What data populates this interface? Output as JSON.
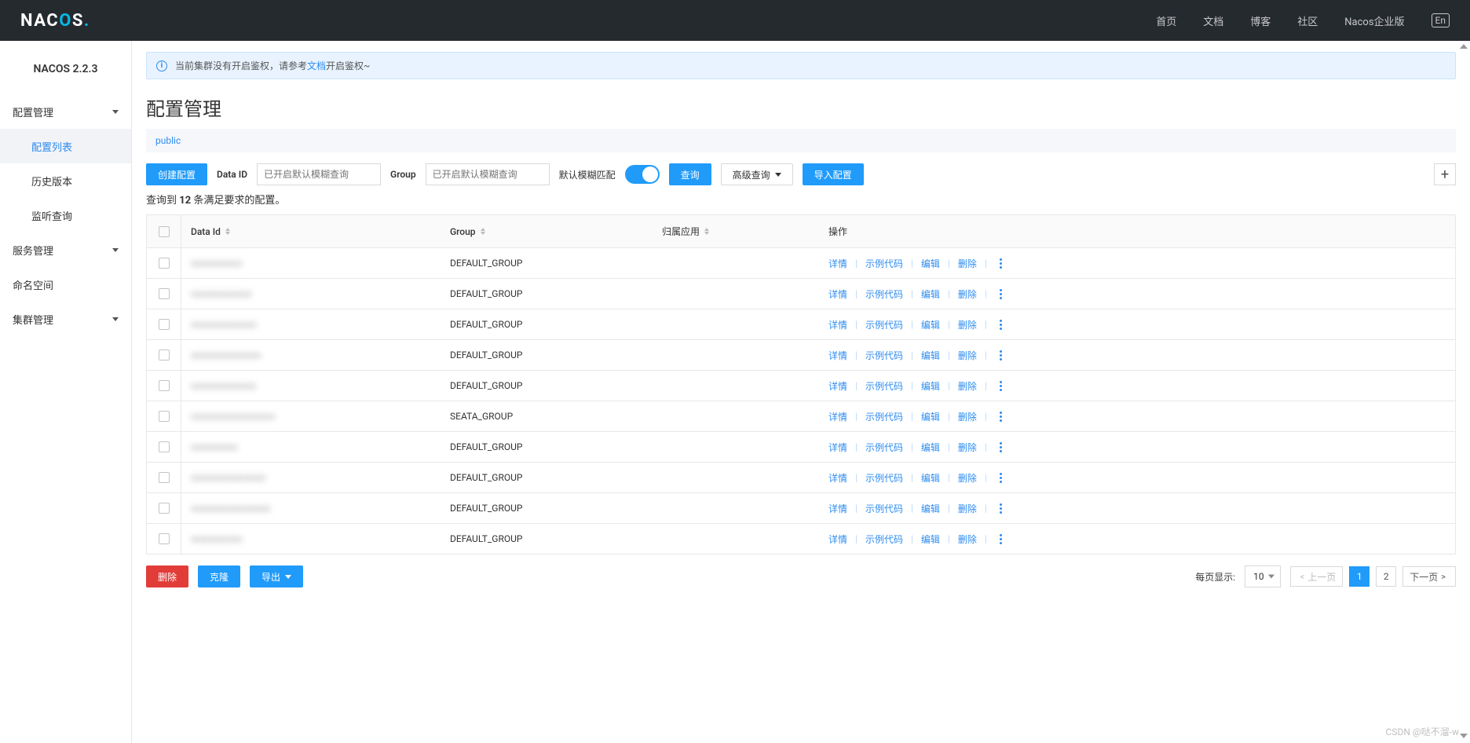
{
  "header": {
    "logo_text": "NACOS",
    "nav": [
      "首页",
      "文档",
      "博客",
      "社区",
      "Nacos企业版"
    ],
    "lang_badge": "En"
  },
  "sidebar": {
    "title": "NACOS 2.2.3",
    "groups": [
      {
        "label": "配置管理",
        "expanded": true,
        "children": [
          {
            "label": "配置列表",
            "active": true
          },
          {
            "label": "历史版本",
            "active": false
          },
          {
            "label": "监听查询",
            "active": false
          }
        ]
      },
      {
        "label": "服务管理",
        "expanded": false
      },
      {
        "label": "命名空间",
        "leaf": true
      },
      {
        "label": "集群管理",
        "expanded": false
      }
    ]
  },
  "notice": {
    "text_before": "当前集群没有开启鉴权，请参考",
    "link_text": "文档",
    "text_after": "开启鉴权~"
  },
  "page": {
    "title": "配置管理",
    "namespace": "public"
  },
  "filters": {
    "create_btn": "创建配置",
    "dataid_label": "Data ID",
    "dataid_placeholder": "已开启默认模糊查询",
    "group_label": "Group",
    "group_placeholder": "已开启默认模糊查询",
    "fuzzy_label": "默认模糊匹配",
    "search_btn": "查询",
    "advanced_btn": "高级查询",
    "import_btn": "导入配置"
  },
  "result_line": {
    "prefix": "查询到 ",
    "count": "12",
    "suffix": " 条满足要求的配置。"
  },
  "table": {
    "headers": {
      "dataid": "Data Id",
      "group": "Group",
      "app": "归属应用",
      "ops": "操作"
    },
    "op_labels": {
      "detail": "详情",
      "example": "示例代码",
      "edit": "编辑",
      "delete": "删除"
    },
    "rows": [
      {
        "dataid": "xxxxxxxxxxx",
        "group": "DEFAULT_GROUP",
        "app": ""
      },
      {
        "dataid": "xxxxxxxxxxxxx",
        "group": "DEFAULT_GROUP",
        "app": ""
      },
      {
        "dataid": "xxxxxxxxxxxxxx",
        "group": "DEFAULT_GROUP",
        "app": ""
      },
      {
        "dataid": "xxxxxxxxxxxxxxx",
        "group": "DEFAULT_GROUP",
        "app": ""
      },
      {
        "dataid": "xxxxxxxxxxxxxx",
        "group": "DEFAULT_GROUP",
        "app": ""
      },
      {
        "dataid": "xxxxxxxxxxxxxxxxxx",
        "group": "SEATA_GROUP",
        "app": ""
      },
      {
        "dataid": "xxxxxxxxxx",
        "group": "DEFAULT_GROUP",
        "app": ""
      },
      {
        "dataid": "xxxxxxxxxxxxxxxx",
        "group": "DEFAULT_GROUP",
        "app": ""
      },
      {
        "dataid": "xxxxxxxxxxxxxxxxx",
        "group": "DEFAULT_GROUP",
        "app": ""
      },
      {
        "dataid": "xxxxxxxxxxx",
        "group": "DEFAULT_GROUP",
        "app": ""
      }
    ]
  },
  "footer": {
    "delete_btn": "删除",
    "clone_btn": "克隆",
    "export_btn": "导出",
    "page_size_label": "每页显示:",
    "page_size": "10",
    "prev": "上一页",
    "next": "下一页",
    "pages": [
      "1",
      "2"
    ],
    "current": "1"
  },
  "watermark": "CSDN @哒不溜-w"
}
